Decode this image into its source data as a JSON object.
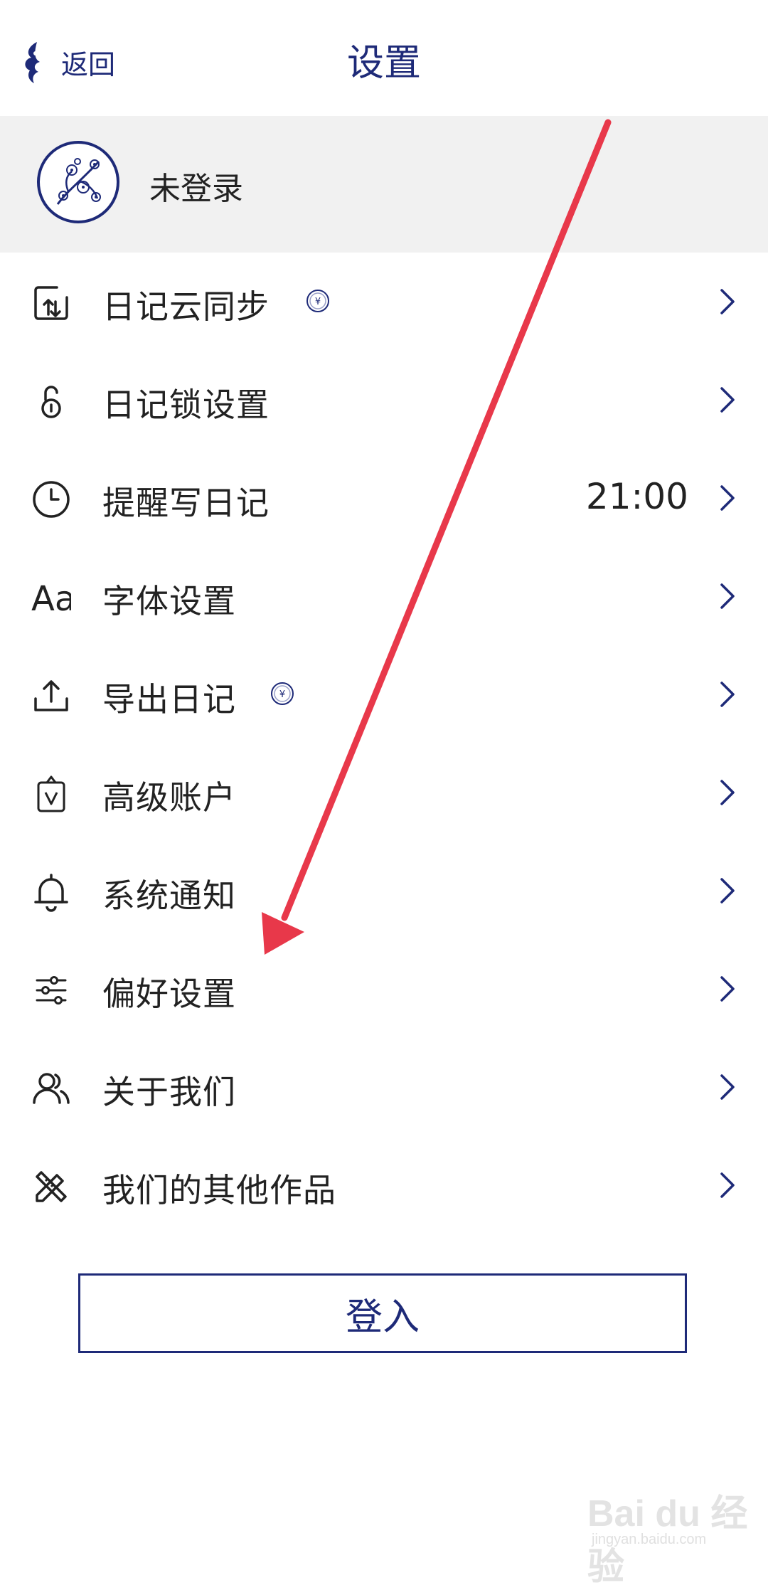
{
  "header": {
    "back_label": "返回",
    "title": "设置"
  },
  "profile": {
    "status_label": "未登录"
  },
  "menu": [
    {
      "label": "日记云同步",
      "premium": true,
      "value": ""
    },
    {
      "label": "日记锁设置",
      "premium": false,
      "value": ""
    },
    {
      "label": "提醒写日记",
      "premium": false,
      "value": "21:00"
    },
    {
      "label": "字体设置",
      "premium": false,
      "value": ""
    },
    {
      "label": "导出日记",
      "premium": true,
      "value": ""
    },
    {
      "label": "高级账户",
      "premium": false,
      "value": ""
    },
    {
      "label": "系统通知",
      "premium": false,
      "value": ""
    },
    {
      "label": "偏好设置",
      "premium": false,
      "value": ""
    },
    {
      "label": "关于我们",
      "premium": false,
      "value": ""
    },
    {
      "label": "我们的其他作品",
      "premium": false,
      "value": ""
    }
  ],
  "icons": {
    "font_icon_text": "Aa",
    "coin_symbol": "¥"
  },
  "login_button": {
    "label": "登入"
  },
  "watermark": {
    "brand": "Bai du 经验",
    "url": "jingyan.baidu.com"
  },
  "colors": {
    "accent": "#1e2a78",
    "annotation_arrow": "#e8384a",
    "profile_bg": "#f1f1f1"
  }
}
